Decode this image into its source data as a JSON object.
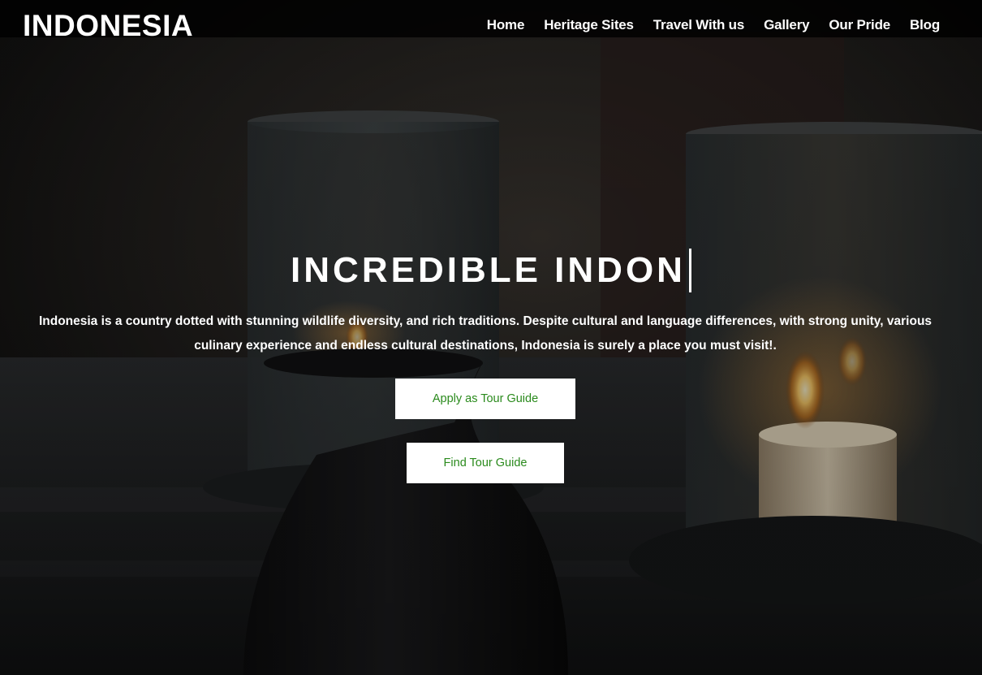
{
  "header": {
    "brand": "INDONESIA",
    "nav": [
      "Home",
      "Heritage Sites",
      "Travel With us",
      "Gallery",
      "Our Pride",
      "Blog"
    ]
  },
  "hero": {
    "headline": "INCREDIBLE INDON",
    "description": "Indonesia is a country dotted with stunning wildlife diversity, and rich traditions. Despite cultural and language differences, with strong unity, various culinary experience and endless cultural destinations, Indonesia is surely a place you must visit!.",
    "buttons": {
      "apply": "Apply as Tour Guide",
      "find": "Find Tour Guide"
    }
  },
  "colors": {
    "button_text": "#2a8a1c",
    "header_bg": "#000000"
  }
}
